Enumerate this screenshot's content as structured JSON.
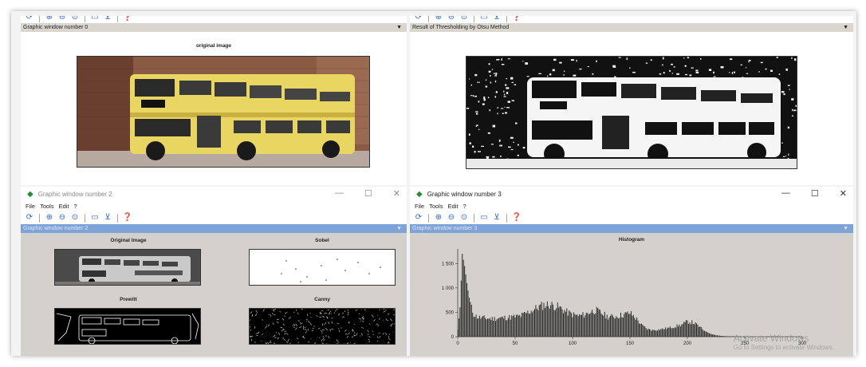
{
  "windows": {
    "w0": {
      "header": "Graphic window number 0",
      "plot_title": "original image"
    },
    "w1": {
      "header": "Result of Thresholding by Otsu Method"
    },
    "w2": {
      "title": "Graphic window number 2",
      "menu": [
        "File",
        "Tools",
        "Edit",
        "?"
      ],
      "header": "Graphic window number 2",
      "subplots": [
        "Original Image",
        "Sobel",
        "Prewitt",
        "Canny"
      ]
    },
    "w3": {
      "title": "Graphic window number 3",
      "menu": [
        "File",
        "Tools",
        "Edit",
        "?"
      ],
      "header": "Graphic window number 3",
      "plot_title": "Histogram"
    }
  },
  "window_controls": {
    "minimize": "—",
    "maximize": "☐",
    "close": "✕"
  },
  "watermark": {
    "line1": "Activate Windows",
    "line2": "Go to Settings to activate Windows."
  },
  "chart_data": {
    "type": "bar",
    "title": "Histogram",
    "xlabel": "",
    "ylabel": "",
    "xlim": [
      0,
      300
    ],
    "ylim": [
      0,
      1800
    ],
    "x_ticks": [
      0,
      50,
      100,
      150,
      200,
      250,
      300
    ],
    "y_ticks": [
      0,
      500,
      1000,
      1500
    ],
    "x_tick_labels": [
      "0",
      "50",
      "100",
      "150",
      "200",
      "250",
      "300"
    ],
    "y_tick_labels": [
      "0",
      "500",
      "1 000",
      "1 500"
    ],
    "x": [
      0,
      2,
      4,
      6,
      8,
      10,
      12,
      14,
      16,
      18,
      20,
      25,
      30,
      35,
      40,
      45,
      50,
      55,
      60,
      65,
      70,
      75,
      80,
      85,
      90,
      95,
      100,
      105,
      110,
      115,
      120,
      125,
      130,
      135,
      140,
      145,
      150,
      155,
      160,
      165,
      170,
      175,
      180,
      185,
      190,
      195,
      200,
      205,
      210,
      215,
      220,
      225,
      230,
      235,
      240,
      245,
      250,
      255
    ],
    "values": [
      150,
      600,
      1700,
      1450,
      1100,
      800,
      600,
      480,
      430,
      410,
      400,
      390,
      380,
      390,
      400,
      410,
      420,
      440,
      500,
      560,
      620,
      670,
      680,
      650,
      600,
      520,
      470,
      440,
      460,
      520,
      560,
      500,
      430,
      420,
      440,
      470,
      500,
      400,
      250,
      160,
      140,
      150,
      170,
      190,
      220,
      250,
      320,
      300,
      220,
      120,
      60,
      30,
      15,
      8,
      5,
      3,
      2,
      1
    ]
  }
}
